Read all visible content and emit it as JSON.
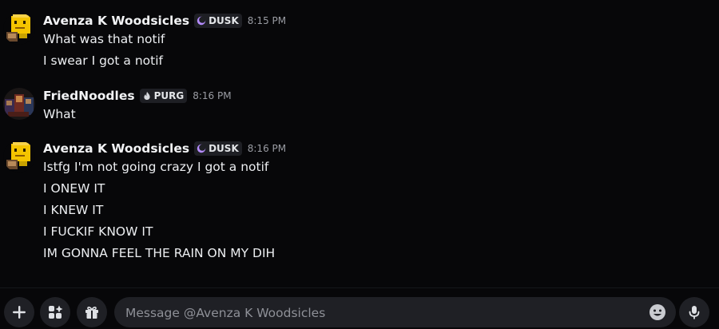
{
  "messages": [
    {
      "username": "Avenza K Woodsicles",
      "tag": "DUSK",
      "tag_icon": "moon-icon",
      "tag_icon_color": "#b58cff",
      "time": "8:15 PM",
      "lines": [
        "What was that notif",
        "I swear I got a notif"
      ]
    },
    {
      "username": "FriedNoodles",
      "tag": "PURG",
      "tag_icon": "flame-icon",
      "tag_icon_color": "#d7d9de",
      "time": "8:16 PM",
      "lines": [
        "What"
      ]
    },
    {
      "username": "Avenza K Woodsicles",
      "tag": "DUSK",
      "tag_icon": "moon-icon",
      "tag_icon_color": "#b58cff",
      "time": "8:16 PM",
      "lines": [
        "Istfg I'm not going crazy I got a notif",
        "I ONEW IT",
        "I KNEW IT",
        "I FUCKIF KNOW IT",
        "IM GONNA FEEL THE RAIN ON MY DIH"
      ]
    }
  ],
  "composer": {
    "placeholder": "Message @Avenza K Woodsicles",
    "value": "",
    "buttons": [
      "plus-icon",
      "apps-icon",
      "gift-icon",
      "emoji-icon",
      "microphone-icon"
    ]
  }
}
